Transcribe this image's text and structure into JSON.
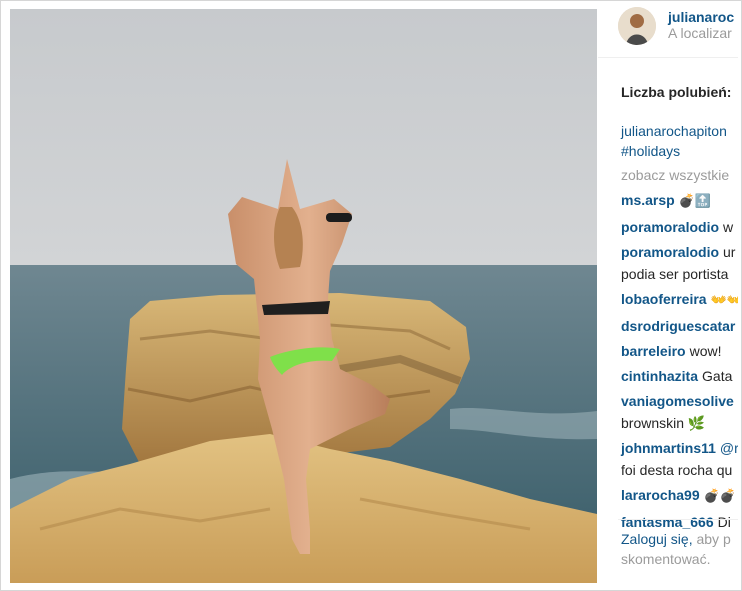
{
  "post": {
    "username": "julianaroc",
    "location": "A localizar",
    "likes_label": "Liczba polubień:",
    "caption_user": "julianarochapiton",
    "caption_tag": "#holidays",
    "view_all": "zobacz wszystkie"
  },
  "comments": [
    {
      "user": "ms.arsp",
      "text": "💣🔝",
      "text2": ""
    },
    {
      "user": "poramoralodio",
      "text": "w",
      "text2": ""
    },
    {
      "user": "poramoralodio",
      "text": "ur",
      "text2": "podia ser portista"
    },
    {
      "user": "lobaoferreira",
      "text": "👐👐",
      "text2": ""
    },
    {
      "user": "dsrodriguescatar",
      "text": "",
      "text2": ""
    },
    {
      "user": "barreleiro",
      "text": "wow!",
      "text2": ""
    },
    {
      "user": "cintinhazita",
      "text": "Gata",
      "text2": ""
    },
    {
      "user": "vaniagomesolive",
      "text": "",
      "text2": "brownskin 🌿"
    },
    {
      "user": "johnmartins11",
      "text": "@ri",
      "text2": "foi desta rocha qu"
    },
    {
      "user": "lararocha99",
      "text": "💣💣",
      "text2": ""
    },
    {
      "user": "fantasma_666",
      "text": "Di",
      "text2": ""
    }
  ],
  "footer": {
    "login_link": "Zaloguj się,",
    "login_rest": " aby p",
    "login_line2": "skomentować."
  },
  "colors": {
    "link": "#125688",
    "muted": "#9b9b9b",
    "text": "#262626"
  }
}
